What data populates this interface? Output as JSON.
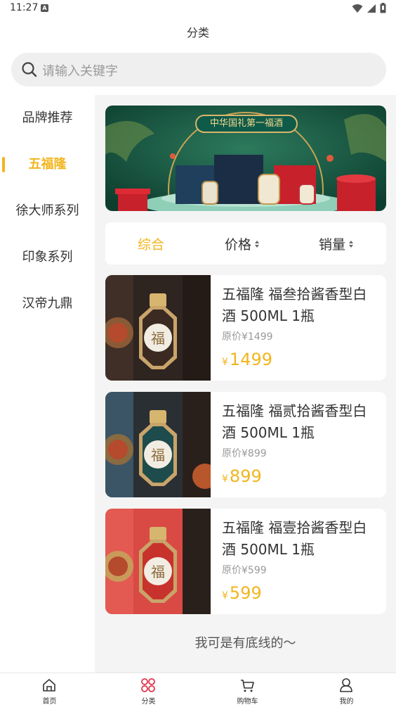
{
  "status_bar": {
    "time": "11:27",
    "sim_label": "A"
  },
  "header": {
    "title": "分类"
  },
  "search": {
    "placeholder": "请输入关键字"
  },
  "sidebar": {
    "items": [
      {
        "label": "品牌推荐",
        "active": false
      },
      {
        "label": "五福隆",
        "active": true
      },
      {
        "label": "徐大师系列",
        "active": false
      },
      {
        "label": "印象系列",
        "active": false
      },
      {
        "label": "汉帝九鼎",
        "active": false
      }
    ]
  },
  "banner": {
    "text": "中华国礼第一福酒"
  },
  "filters": {
    "items": [
      {
        "label": "综合",
        "active": true,
        "sortable": false
      },
      {
        "label": "价格",
        "active": false,
        "sortable": true
      },
      {
        "label": "销量",
        "active": false,
        "sortable": true
      }
    ]
  },
  "products": [
    {
      "name": "五福隆 福叁拾酱香型白酒 500ML 1瓶",
      "original_price": "原价¥1499",
      "currency": "¥",
      "price": "1499",
      "bottle_color": "#3a2a22"
    },
    {
      "name": "五福隆 福贰拾酱香型白酒 500ML 1瓶",
      "original_price": "原价¥899",
      "currency": "¥",
      "price": "899",
      "bottle_color": "#1e4b4b"
    },
    {
      "name": "五福隆 福壹拾酱香型白酒 500ML 1瓶",
      "original_price": "原价¥599",
      "currency": "¥",
      "price": "599",
      "bottle_color": "#c8322c"
    }
  ],
  "list_footer": "我可是有底线的～",
  "tabbar": {
    "items": [
      {
        "label": "首页",
        "icon": "home-icon",
        "active": false
      },
      {
        "label": "分类",
        "icon": "category-grid-icon",
        "active": true
      },
      {
        "label": "购物车",
        "icon": "cart-icon",
        "active": false
      },
      {
        "label": "我的",
        "icon": "profile-icon",
        "active": false
      }
    ]
  },
  "colors": {
    "accent": "#f2b51d",
    "tab_active_icon": "#e0344d"
  }
}
